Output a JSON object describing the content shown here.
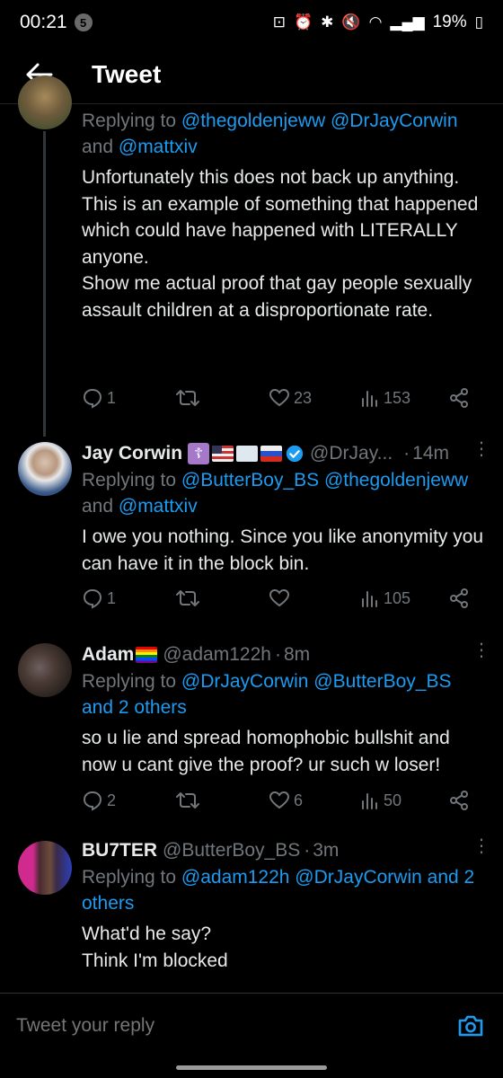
{
  "status_bar": {
    "time": "00:21",
    "notification_count": "5",
    "battery": "19%"
  },
  "header": {
    "title": "Tweet"
  },
  "tweets": [
    {
      "reply_to_prefix": "Replying to ",
      "reply_to_users": "@thegoldenjeww @DrJayCorwin",
      "reply_to_and": "and ",
      "reply_to_last": "@mattxiv",
      "text": "Unfortunately this does not back up anything.\nThis is an example of something that happened which could have happened with LITERALLY anyone.\nShow me actual proof that gay people sexually assault children at a disproportionate rate.",
      "replies": "1",
      "retweets": "",
      "likes": "23",
      "views": "153"
    },
    {
      "name": "Jay Corwin",
      "handle": "@DrJay...",
      "time": "14m",
      "dot": "·",
      "reply_to_prefix": "Replying to ",
      "reply_to_users": "@ButterBoy_BS @thegoldenjeww",
      "reply_to_and": "and ",
      "reply_to_last": "@mattxiv",
      "text": "I owe you nothing.  Since you like anonymity you can have it in the block bin.",
      "replies": "1",
      "retweets": "",
      "likes": "",
      "views": "105"
    },
    {
      "name": "Adam",
      "handle": "@adam122h",
      "time": "8m",
      "dot": "·",
      "reply_to_prefix": "Replying to ",
      "reply_to_users": "@DrJayCorwin @ButterBoy_BS",
      "reply_to_and": "",
      "reply_to_last": "and 2 others",
      "text": "so u lie and spread homophobic bullshit and now u cant give the proof? ur such w loser!",
      "replies": "2",
      "retweets": "",
      "likes": "6",
      "views": "50"
    },
    {
      "name": "BU7TER",
      "handle": "@ButterBoy_BS",
      "time": "3m",
      "dot": "·",
      "reply_to_prefix": "Replying to ",
      "reply_to_users": "@adam122h @DrJayCorwin and 2",
      "reply_to_and": "",
      "reply_to_last": "others",
      "text": "What'd he say?\nThink I'm blocked"
    }
  ],
  "reply_bar": {
    "placeholder": "Tweet your reply"
  },
  "icons": {
    "back": "arrow-left-icon",
    "reply": "speech-bubble-icon",
    "retweet": "retweet-icon",
    "like": "heart-icon",
    "views": "bar-chart-icon",
    "share": "share-icon",
    "camera": "camera-icon",
    "more": "more-vertical-icon",
    "verified": "verified-badge-icon"
  },
  "colors": {
    "link": "#1d9bf0",
    "muted": "#71767b",
    "text": "#e7e9ea",
    "background": "#000000"
  }
}
